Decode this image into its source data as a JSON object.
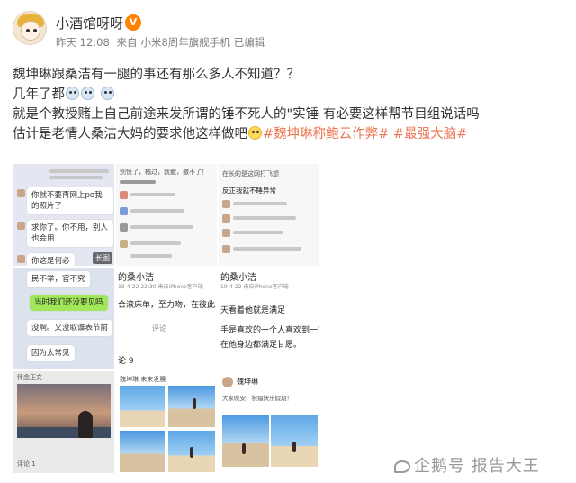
{
  "post": {
    "username": "小酒馆呀呀",
    "time": "昨天 12:08",
    "source_prefix": "来自",
    "source": "小米8周年旗舰手机",
    "edited": "已编辑",
    "lines": [
      "魏坤琳跟桑洁有一腿的事还有那么多人不知道？？",
      "几年了都",
      "就是个教授赌上自己前途来发所谓的锤不死人的\"实锤 有必要这样帮节目组说话吗",
      "估计是老情人桑洁大妈的要求他这样做吧"
    ],
    "hashtags": [
      "#魏坤琳称鲍云作弊#",
      "#最强大脑#"
    ]
  },
  "images": {
    "tile1": {
      "bubbles": [
        "你就不要再网上po我的照片了",
        "求你了。你不用，别人也会用",
        "你这是何必"
      ],
      "long_tag": "长图"
    },
    "tile2": {
      "header": "别慌了，橘过，就撤，撤不了！"
    },
    "tile3": {
      "text": [
        "在长的是这网打飞想",
        "反正我就不睡异常"
      ]
    },
    "tile4": {
      "bubbles": [
        "民不举，官不究",
        "当时我们还没要见吗",
        "没啊。又没取谁表节前",
        "因为太常见"
      ]
    },
    "tile5": {
      "name": "的桑小洁",
      "meta": "19-4-22 22:30 来自iPhone客户端",
      "body": "合滚床单，至力吻，在彼此",
      "comment": "评论",
      "footer": "论 9"
    },
    "tile6": {
      "name": "的桑小洁",
      "meta": "19-4-22 来自iPhone客户端",
      "body": [
        "天看着他就是满足",
        "手是喜欢的一个人喜欢到一定",
        "在他身边都满足甘愿。"
      ]
    },
    "tile7": {
      "title": "怀念正文",
      "footer": "评论 1"
    },
    "tile8": {
      "header": "魏坤琳 未来发展"
    },
    "tile9": {
      "name": "魏坤琳",
      "meta": "大家晚安！祝福快乐假期！"
    }
  },
  "watermark": "企鹅号 报告大王",
  "colors": {
    "hashtag": "#eb7350",
    "meta": "#808080",
    "text": "#333333"
  }
}
